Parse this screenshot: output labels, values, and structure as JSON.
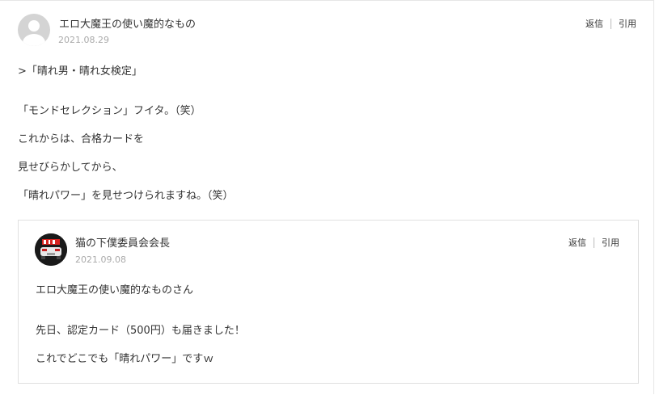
{
  "comment": {
    "author": "エロ大魔王の使い魔的なもの",
    "date": "2021.08.29",
    "actions": {
      "reply": "返信",
      "quote": "引用"
    },
    "lines": [
      ">「晴れ男・晴れ女検定」",
      "「モンドセレクション」フイタ。（笑）",
      "これからは、合格カードを",
      "見せびらかしてから、",
      "「晴れパワー」を見せつけられますね。（笑）"
    ]
  },
  "reply": {
    "author": "猫の下僕委員会会長",
    "date": "2021.09.08",
    "actions": {
      "reply": "返信",
      "quote": "引用"
    },
    "lines": [
      "エロ大魔王の使い魔的なものさん",
      "先日、認定カード（500円）も届きました！",
      "これでどこでも「晴れパワー」ですｗ"
    ]
  },
  "colors": {
    "text": "#333333",
    "date": "#aaaaaa",
    "border": "#e0e0e0",
    "avatar_default": "#d4d4d4"
  }
}
